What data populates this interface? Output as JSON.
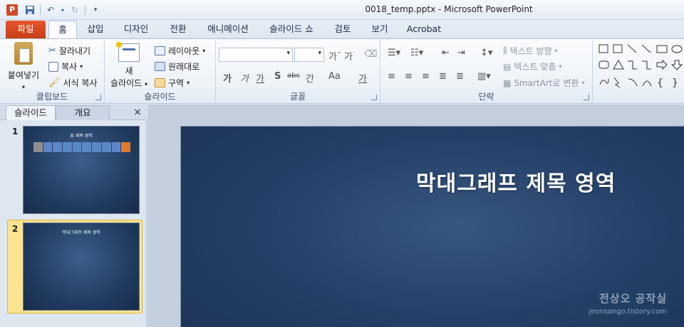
{
  "window": {
    "app_icon": "P",
    "title": "0018_temp.pptx  -  Microsoft PowerPoint"
  },
  "quick_access": {
    "icons": [
      "save-icon",
      "undo-icon",
      "redo-icon",
      "customize-icon"
    ]
  },
  "tabs": [
    {
      "label": "파일",
      "active": false
    },
    {
      "label": "홈",
      "active": true
    },
    {
      "label": "삽입",
      "active": false
    },
    {
      "label": "디자인",
      "active": false
    },
    {
      "label": "전환",
      "active": false
    },
    {
      "label": "애니메이션",
      "active": false
    },
    {
      "label": "슬라이드 쇼",
      "active": false
    },
    {
      "label": "검토",
      "active": false
    },
    {
      "label": "보기",
      "active": false
    },
    {
      "label": "Acrobat",
      "active": false
    }
  ],
  "ribbon": {
    "clipboard": {
      "label": "클립보드",
      "paste": "붙여넣기",
      "cut": "잘라내기",
      "copy": "복사",
      "format_painter": "서식 복사"
    },
    "slides": {
      "label": "슬라이드",
      "new_slide_line1": "새",
      "new_slide_line2": "슬라이드",
      "layout": "레이아웃",
      "reset": "원래대로",
      "section": "구역"
    },
    "font": {
      "label": "글꼴",
      "buttons": [
        "가",
        "가",
        "가",
        "S",
        "abc",
        "간",
        "Aa",
        "가"
      ]
    },
    "paragraph": {
      "label": "단락",
      "text_direction": "텍스트 방향",
      "align_text": "텍스트 맞춤",
      "smartart": "SmartArt로 변환"
    }
  },
  "left_pane": {
    "tabs": [
      "슬라이드",
      "개요"
    ],
    "close": "×",
    "slides": [
      {
        "number": "1",
        "title": "표 제목 영역",
        "selected": false
      },
      {
        "number": "2",
        "title": "막대그래프 제목 영역",
        "selected": true
      }
    ]
  },
  "slide": {
    "title": "막대그래프 제목 영역",
    "watermark_name": "전상오 공작실",
    "watermark_url": "jeonsango.tistory.com"
  },
  "colors": {
    "file_tab": "#d24726",
    "slide_bg": "#26426a",
    "selected_thumb": "#fbe38f"
  }
}
